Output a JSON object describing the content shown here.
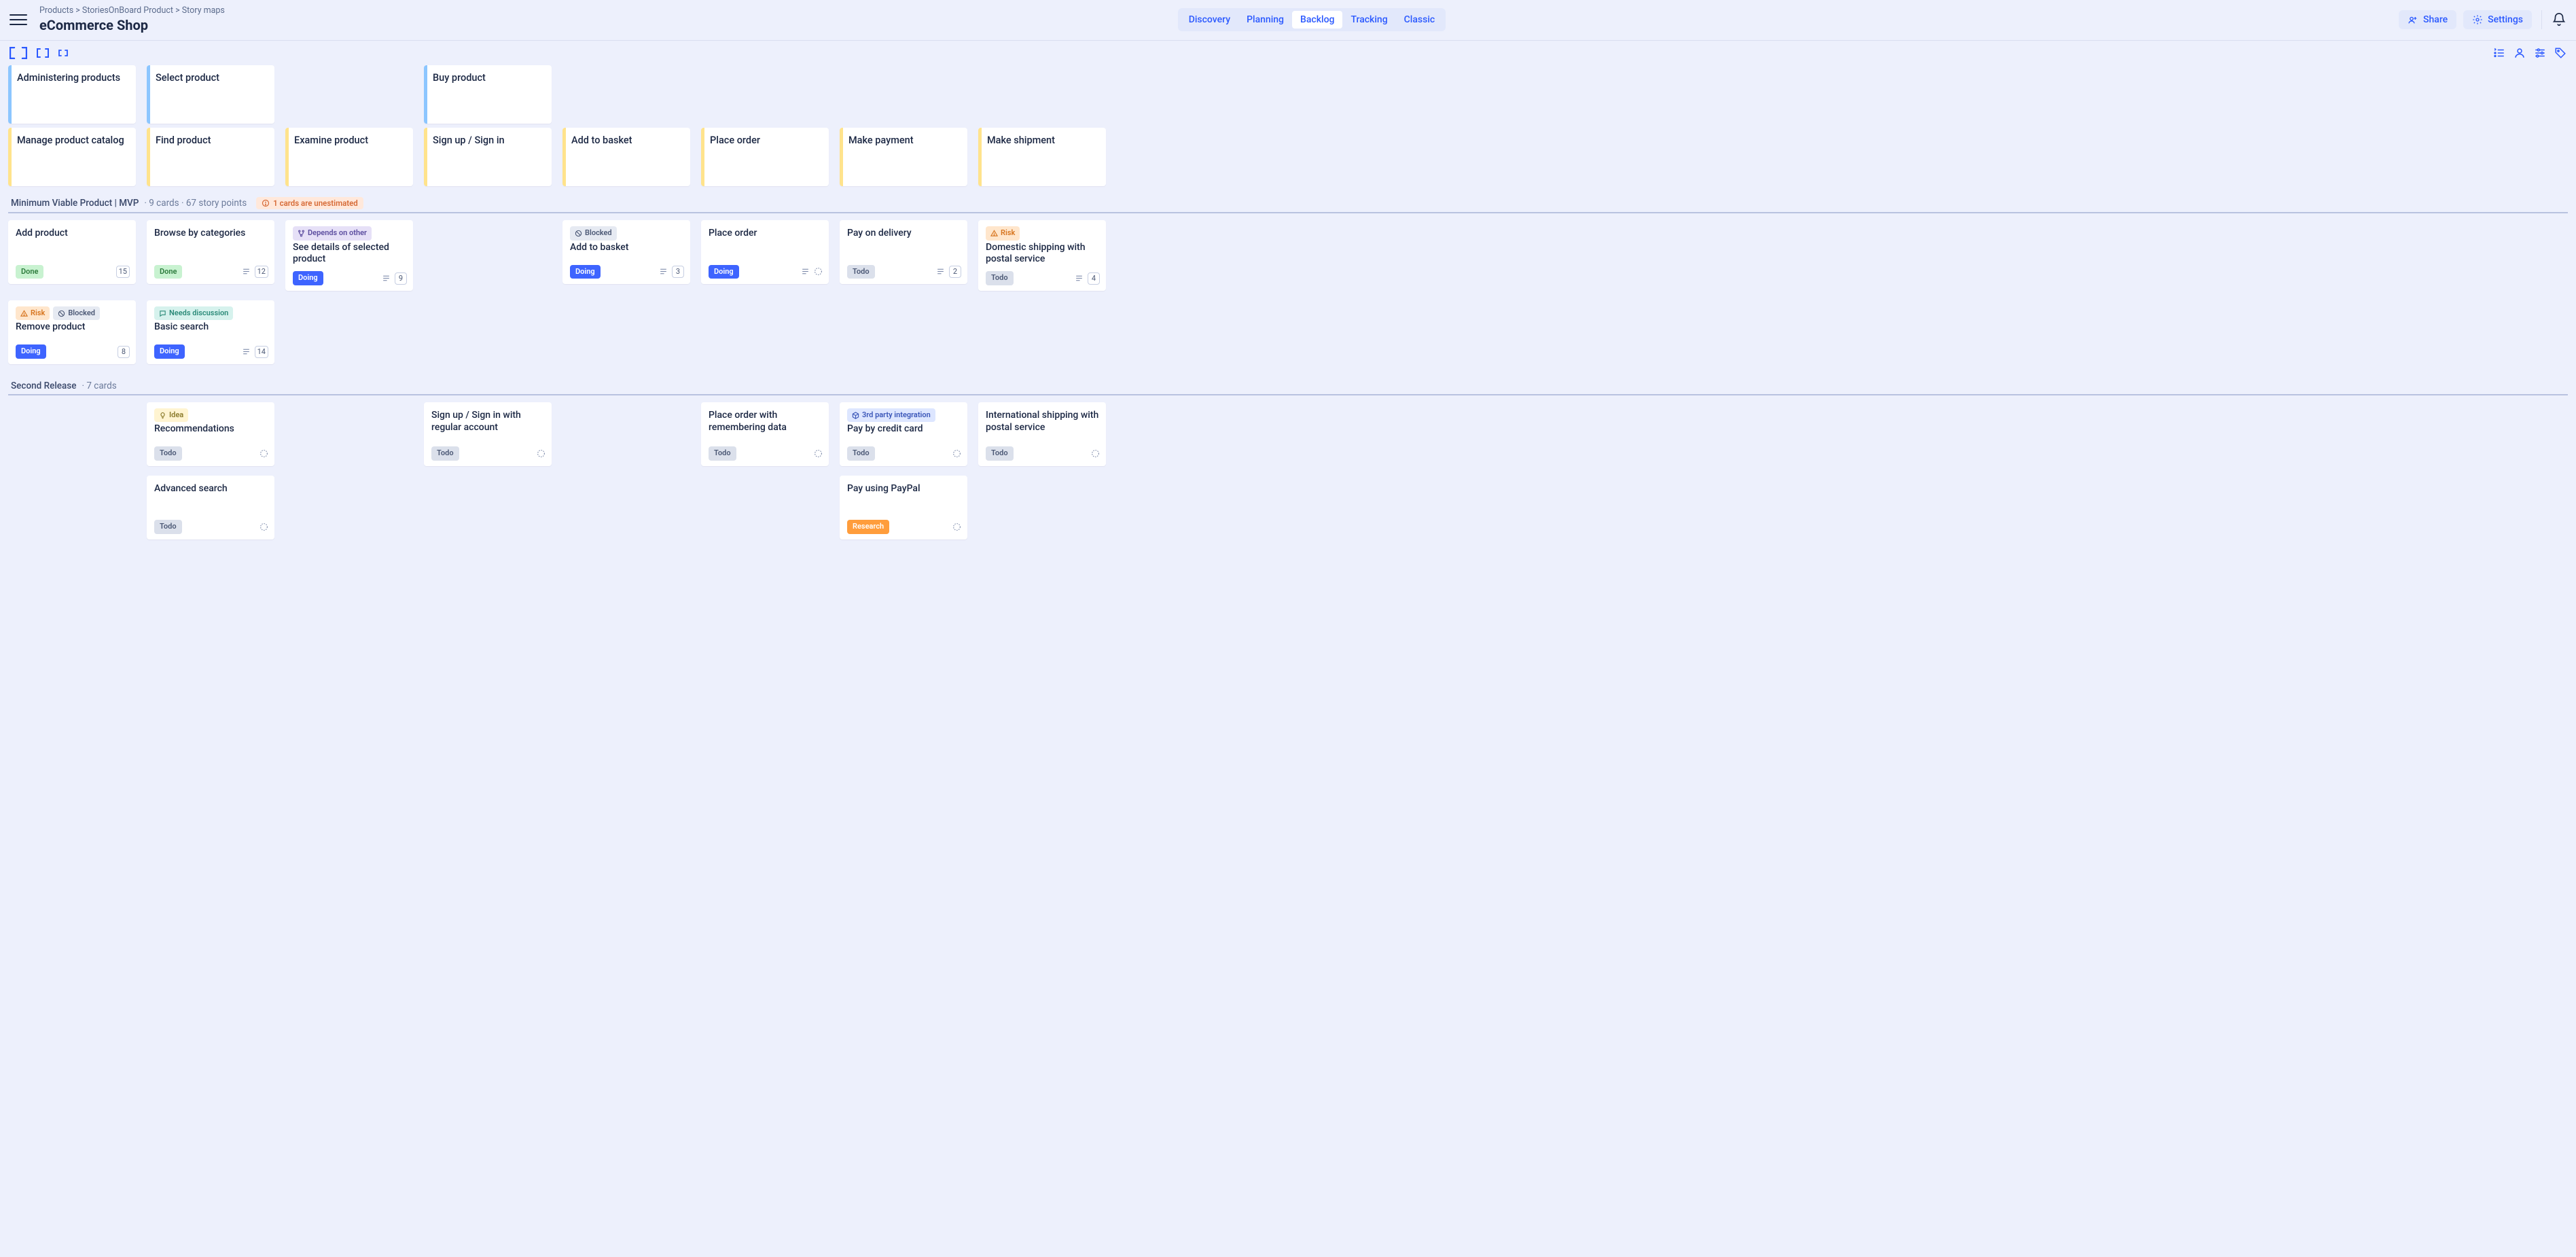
{
  "breadcrumbs": [
    "Products",
    "StoriesOnBoard Product",
    "Story maps"
  ],
  "title": "eCommerce Shop",
  "tabs": [
    {
      "label": "Discovery",
      "active": false
    },
    {
      "label": "Planning",
      "active": false
    },
    {
      "label": "Backlog",
      "active": true
    },
    {
      "label": "Tracking",
      "active": false
    },
    {
      "label": "Classic",
      "active": false
    }
  ],
  "header_buttons": {
    "share": "Share",
    "settings": "Settings"
  },
  "columns": [
    {
      "epic": "Administering products",
      "activity": "Manage product catalog"
    },
    {
      "epic": "Select product",
      "activity": "Find product"
    },
    {
      "epic": null,
      "activity": "Examine product"
    },
    {
      "epic": "Buy product",
      "activity": "Sign up / Sign in"
    },
    {
      "epic": null,
      "activity": "Add to basket"
    },
    {
      "epic": null,
      "activity": "Place order"
    },
    {
      "epic": null,
      "activity": "Make payment"
    },
    {
      "epic": null,
      "activity": "Make shipment"
    }
  ],
  "releases": [
    {
      "name": "Minimum Viable Product | MVP",
      "meta": "9 cards · 67 story points",
      "warning": "1 cards are unestimated",
      "rows": [
        [
          {
            "title": "Add product",
            "tags": [],
            "status": "Done",
            "status_class": "b-done",
            "points": "15",
            "has_desc": false,
            "unestimated": false
          },
          {
            "title": "Browse by categories",
            "tags": [],
            "status": "Done",
            "status_class": "b-done",
            "points": "12",
            "has_desc": true,
            "unestimated": false
          },
          {
            "title": "See details of selected product",
            "tags": [
              {
                "cls": "t-depends",
                "icon": "branch",
                "label": "Depends on other"
              }
            ],
            "status": "Doing",
            "status_class": "b-doing",
            "points": "9",
            "has_desc": true,
            "unestimated": false
          },
          null,
          {
            "title": "Add to basket",
            "tags": [
              {
                "cls": "t-blocked",
                "icon": "block",
                "label": "Blocked"
              }
            ],
            "status": "Doing",
            "status_class": "b-doing",
            "points": "3",
            "has_desc": true,
            "unestimated": false
          },
          {
            "title": "Place order",
            "tags": [],
            "status": "Doing",
            "status_class": "b-doing",
            "points": null,
            "has_desc": true,
            "unestimated": true
          },
          {
            "title": "Pay on delivery",
            "tags": [],
            "status": "Todo",
            "status_class": "b-todo",
            "points": "2",
            "has_desc": true,
            "unestimated": false
          },
          {
            "title": "Domestic shipping with postal service",
            "tags": [
              {
                "cls": "t-risk",
                "icon": "warn",
                "label": "Risk"
              }
            ],
            "status": "Todo",
            "status_class": "b-todo",
            "points": "4",
            "has_desc": true,
            "unestimated": false
          }
        ],
        [
          {
            "title": "Remove product",
            "tags": [
              {
                "cls": "t-risk",
                "icon": "warn",
                "label": "Risk"
              },
              {
                "cls": "t-blocked",
                "icon": "block",
                "label": "Blocked"
              }
            ],
            "status": "Doing",
            "status_class": "b-doing",
            "points": "8",
            "has_desc": false,
            "unestimated": false
          },
          {
            "title": "Basic search",
            "tags": [
              {
                "cls": "t-needs",
                "icon": "chat",
                "label": "Needs discussion"
              }
            ],
            "status": "Doing",
            "status_class": "b-doing",
            "points": "14",
            "has_desc": true,
            "unestimated": false
          },
          null,
          null,
          null,
          null,
          null,
          null
        ]
      ]
    },
    {
      "name": "Second Release",
      "meta": "7 cards",
      "warning": null,
      "rows": [
        [
          null,
          {
            "title": "Recommendations",
            "tags": [
              {
                "cls": "t-idea",
                "icon": "idea",
                "label": "Idea"
              }
            ],
            "status": "Todo",
            "status_class": "b-todo",
            "points": null,
            "has_desc": false,
            "unestimated": true
          },
          null,
          {
            "title": "Sign up / Sign in with regular account",
            "tags": [],
            "status": "Todo",
            "status_class": "b-todo",
            "points": null,
            "has_desc": false,
            "unestimated": true
          },
          null,
          {
            "title": "Place order with remembering data",
            "tags": [],
            "status": "Todo",
            "status_class": "b-todo",
            "points": null,
            "has_desc": false,
            "unestimated": true
          },
          {
            "title": "Pay by credit card",
            "tags": [
              {
                "cls": "t-3p",
                "icon": "cube",
                "label": "3rd party integration"
              }
            ],
            "status": "Todo",
            "status_class": "b-todo",
            "points": null,
            "has_desc": false,
            "unestimated": true
          },
          {
            "title": "International shipping with postal service",
            "tags": [],
            "status": "Todo",
            "status_class": "b-todo",
            "points": null,
            "has_desc": false,
            "unestimated": true
          }
        ],
        [
          null,
          {
            "title": "Advanced search",
            "tags": [],
            "status": "Todo",
            "status_class": "b-todo",
            "points": null,
            "has_desc": false,
            "unestimated": true
          },
          null,
          null,
          null,
          null,
          {
            "title": "Pay using PayPal",
            "tags": [],
            "status": "Research",
            "status_class": "b-research",
            "points": null,
            "has_desc": false,
            "unestimated": true
          },
          null
        ]
      ]
    }
  ]
}
